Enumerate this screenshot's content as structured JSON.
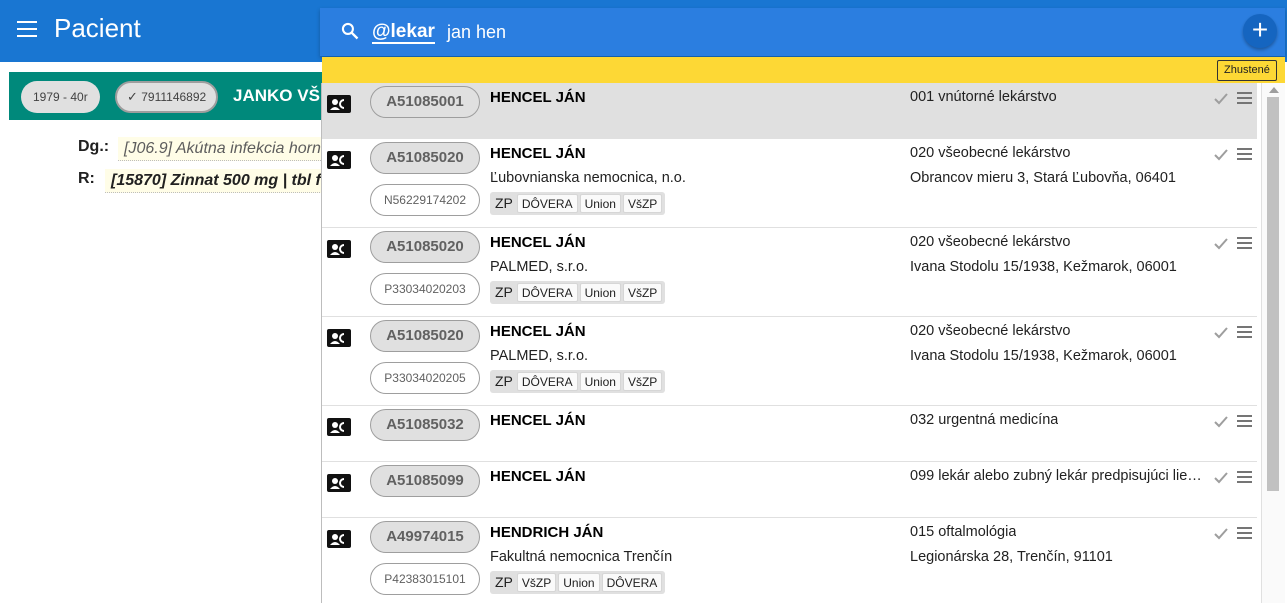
{
  "app": {
    "title": "Pacient"
  },
  "patient": {
    "age_chip": "1979 - 40r",
    "rc_chip": "7911146892",
    "name": "JANKO VŠ"
  },
  "record": {
    "dg_label": "Dg.:",
    "dg_value": "[J06.9] Akútna infekcia horn",
    "r_label": "R:",
    "r_value": "[15870] Zinnat 500 mg | tbl fl"
  },
  "search": {
    "tag": "@lekar",
    "query": "jan hen"
  },
  "filter_chip": "Zhustené",
  "results": [
    {
      "code": "A51085001",
      "sub_code": "",
      "name": "HENCEL JÁN",
      "org": "",
      "spec": "001 vnútorné lekárstvo",
      "address": "",
      "insurers": [],
      "selected": true
    },
    {
      "code": "A51085020",
      "sub_code": "N56229174202",
      "name": "HENCEL JÁN",
      "org": "Ľubovnianska nemocnica, n.o.",
      "spec": "020 všeobecné lekárstvo",
      "address": "Obrancov mieru 3, Stará Ľubovňa, 06401",
      "insurers": [
        "DÔVERA",
        "Union",
        "VšZP"
      ],
      "selected": false
    },
    {
      "code": "A51085020",
      "sub_code": "P33034020203",
      "name": "HENCEL JÁN",
      "org": "PALMED, s.r.o.",
      "spec": "020 všeobecné lekárstvo",
      "address": "Ivana Stodolu 15/1938, Kežmarok, 06001",
      "insurers": [
        "DÔVERA",
        "Union",
        "VšZP"
      ],
      "selected": false
    },
    {
      "code": "A51085020",
      "sub_code": "P33034020205",
      "name": "HENCEL JÁN",
      "org": "PALMED, s.r.o.",
      "spec": "020 všeobecné lekárstvo",
      "address": "Ivana Stodolu 15/1938, Kežmarok, 06001",
      "insurers": [
        "DÔVERA",
        "Union",
        "VšZP"
      ],
      "selected": false
    },
    {
      "code": "A51085032",
      "sub_code": "",
      "name": "HENCEL JÁN",
      "org": "",
      "spec": "032 urgentná medicína",
      "address": "",
      "insurers": [],
      "selected": false
    },
    {
      "code": "A51085099",
      "sub_code": "",
      "name": "HENCEL JÁN",
      "org": "",
      "spec": "099 lekár alebo zubný lekár predpisujúci lie…",
      "address": "",
      "insurers": [],
      "selected": false
    },
    {
      "code": "A49974015",
      "sub_code": "P42383015101",
      "name": "HENDRICH JÁN",
      "org": "Fakultná nemocnica Trenčín",
      "spec": "015 oftalmológia",
      "address": "Legionárska 28, Trenčín, 91101",
      "insurers": [
        "VšZP",
        "Union",
        "DÔVERA"
      ],
      "selected": false
    }
  ],
  "zp_label": "ZP",
  "icons": {
    "menu": "menu-icon",
    "search": "search-icon",
    "add": "plus-icon",
    "card": "contact-card-icon",
    "check": "check-icon",
    "drag": "drag-handle-icon"
  },
  "colors": {
    "appbar": "#1976d2",
    "patient_bar": "#00897b",
    "search_bar": "#2b7ee0",
    "strip": "#fdd835"
  }
}
